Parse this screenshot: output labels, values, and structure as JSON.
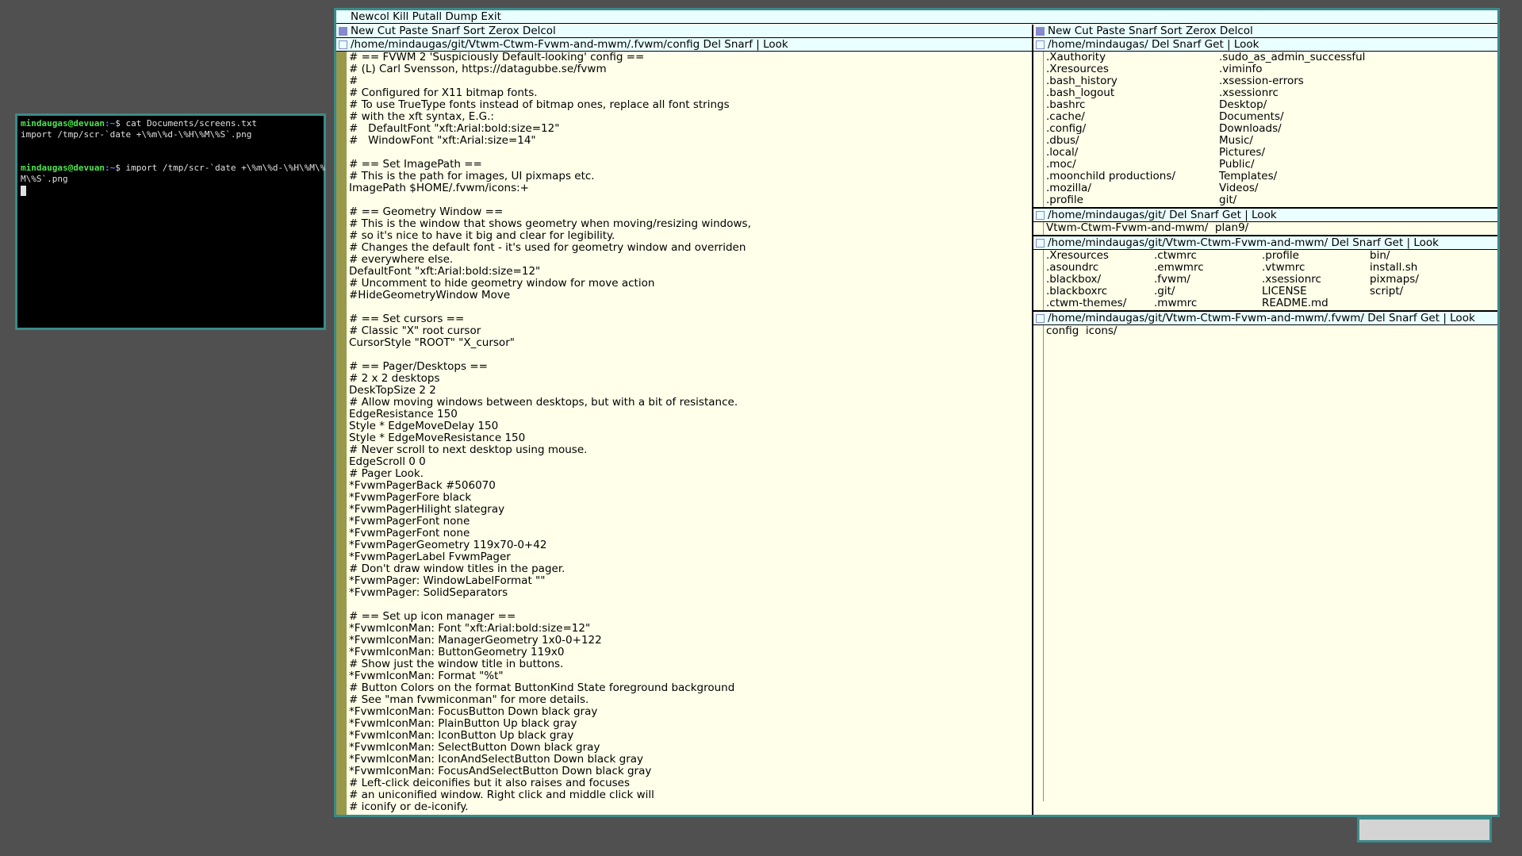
{
  "terminal": {
    "user": "mindaugas@devuan",
    "path": ":~",
    "lines": [
      {
        "cmd": "$ cat Documents/screens.txt"
      },
      {
        "out": "import /tmp/scr-`date +\\%m\\%d-\\%H\\%M\\%S`.png"
      },
      {
        "out": ""
      },
      {
        "cmd": "$ import /tmp/scr-`date +\\%m\\%d-\\%H\\%M\\%S`.png"
      }
    ],
    "cmd2_wrap": "M\\%S`.png",
    "cmd2_first": "$ import /tmp/scr-`date +\\%m\\%d-\\%H\\%M\\%"
  },
  "acme": {
    "row_tag": "Newcol Kill Putall Dump Exit",
    "left_col_tag": "New Cut Paste Snarf Sort Zerox Delcol",
    "right_col_tag": "New Cut Paste Snarf Sort Zerox Delcol",
    "config_win": {
      "tag": "/home/mindaugas/git/Vtwm-Ctwm-Fvwm-and-mwm/.fvwm/config Del Snarf | Look",
      "body": "# == FVWM 2 'Suspiciously Default-looking' config ==\n# (L) Carl Svensson, https://datagubbe.se/fvwm\n#\n# Configured for X11 bitmap fonts.\n# To use TrueType fonts instead of bitmap ones, replace all font strings\n# with the xft syntax, E.G.:\n#   DefaultFont \"xft:Arial:bold:size=12\"\n#   WindowFont \"xft:Arial:size=14\"\n\n# == Set ImagePath ==\n# This is the path for images, UI pixmaps etc.\nImagePath $HOME/.fvwm/icons:+\n\n# == Geometry Window ==\n# This is the window that shows geometry when moving/resizing windows,\n# so it's nice to have it big and clear for legibility.\n# Changes the default font - it's used for geometry window and overriden\n# everywhere else.\nDefaultFont \"xft:Arial:bold:size=12\"\n# Uncomment to hide geometry window for move action\n#HideGeometryWindow Move\n\n# == Set cursors ==\n# Classic \"X\" root cursor\nCursorStyle \"ROOT\" \"X_cursor\"\n\n# == Pager/Desktops ==\n# 2 x 2 desktops\nDeskTopSize 2 2\n# Allow moving windows between desktops, but with a bit of resistance.\nEdgeResistance 150\nStyle * EdgeMoveDelay 150\nStyle * EdgeMoveResistance 150\n# Never scroll to next desktop using mouse.\nEdgeScroll 0 0\n# Pager Look.\n*FvwmPagerBack #506070\n*FvwmPagerFore black\n*FvwmPagerHilight slategray\n*FvwmPagerFont none\n*FvwmPagerFont none\n*FvwmPagerGeometry 119x70-0+42\n*FvwmPagerLabel FvwmPager\n# Don't draw window titles in the pager.\n*FvwmPager: WindowLabelFormat \"\"\n*FvwmPager: SolidSeparators\n\n# == Set up icon manager ==\n*FvwmIconMan: Font \"xft:Arial:bold:size=12\"\n*FvwmIconMan: ManagerGeometry 1x0-0+122\n*FvwmIconMan: ButtonGeometry 119x0\n# Show just the window title in buttons.\n*FvwmIconMan: Format \"%t\"\n# Button Colors on the format ButtonKind State foreground background\n# See \"man fvwmiconman\" for more details.\n*FvwmIconMan: FocusButton Down black gray\n*FvwmIconMan: PlainButton Up black gray\n*FvwmIconMan: IconButton Up black gray\n*FvwmIconMan: SelectButton Down black gray\n*FvwmIconMan: IconAndSelectButton Down black gray\n*FvwmIconMan: FocusAndSelectButton Down black gray\n# Left-click deiconifies but it also raises and focuses\n# an uniconified window. Right click and middle click will\n# iconify or de-iconify."
    },
    "home_win": {
      "tag": "/home/mindaugas/ Del Snarf Get | Look",
      "entries": [
        ".Xauthority",
        ".sudo_as_admin_successful",
        ".Xresources",
        ".viminfo",
        ".bash_history",
        ".xsession-errors",
        ".bash_logout",
        ".xsessionrc",
        ".bashrc",
        "Desktop/",
        ".cache/",
        "Documents/",
        ".config/",
        "Downloads/",
        ".dbus/",
        "Music/",
        ".local/",
        "Pictures/",
        ".moc/",
        "Public/",
        ".moonchild productions/",
        "Templates/",
        ".mozilla/",
        "Videos/",
        ".profile",
        "git/"
      ]
    },
    "git_win": {
      "tag": "/home/mindaugas/git/ Del Snarf Get | Look",
      "body": "Vtwm-Ctwm-Fvwm-and-mwm/  plan9/"
    },
    "repo_win": {
      "tag": "/home/mindaugas/git/Vtwm-Ctwm-Fvwm-and-mwm/ Del Snarf Get | Look",
      "entries": [
        ".Xresources",
        ".ctwmrc",
        ".profile",
        "bin/",
        ".asoundrc",
        ".emwmrc",
        ".vtwmrc",
        "install.sh",
        ".blackbox/",
        ".fvwm/",
        ".xsessionrc",
        "pixmaps/",
        ".blackboxrc",
        ".git/",
        "LICENSE",
        "script/",
        ".ctwm-themes/",
        ".mwmrc",
        "README.md",
        ""
      ]
    },
    "fvwm_win": {
      "tag": "/home/mindaugas/git/Vtwm-Ctwm-Fvwm-and-mwm/.fvwm/ Del Snarf Get | Look",
      "body": "config  icons/"
    }
  },
  "colors": {
    "tag_bg": "#eaffff",
    "body_bg": "#ffffea",
    "scroll_thumb": "#99994c",
    "border": "#3c8a8a",
    "desktop": "#505050"
  }
}
